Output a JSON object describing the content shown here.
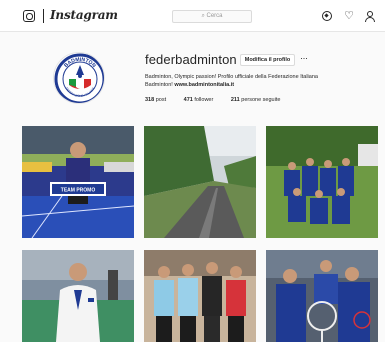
{
  "nav": {
    "brand": "Instagram",
    "search_placeholder": "Cerca",
    "icons": [
      "instagram-glyph-icon",
      "compass-icon",
      "heart-icon",
      "user-icon"
    ]
  },
  "profile": {
    "username": "federbadminton",
    "edit_button": "Modifica il profilo",
    "more": "···",
    "bio_line1": "Badminton, Olympic passion! Profilo ufficiale della Federazione Italiana",
    "bio_line2": "Badminton!",
    "bio_link": "www.badmintonitalia.it",
    "stats": [
      {
        "count": "318",
        "label": "post"
      },
      {
        "count": "471",
        "label": "follower"
      },
      {
        "count": "211",
        "label": "persone seguite"
      }
    ],
    "logo_text": "BADMINTON",
    "logo_subtext": "FEDERAZIONE ITALIANA"
  },
  "posts": {
    "post1_banner": "TEAM PROMO"
  },
  "colors": {
    "accent_blue": "#1f3a93",
    "border": "#dbdbdb",
    "background": "#fafafa"
  }
}
